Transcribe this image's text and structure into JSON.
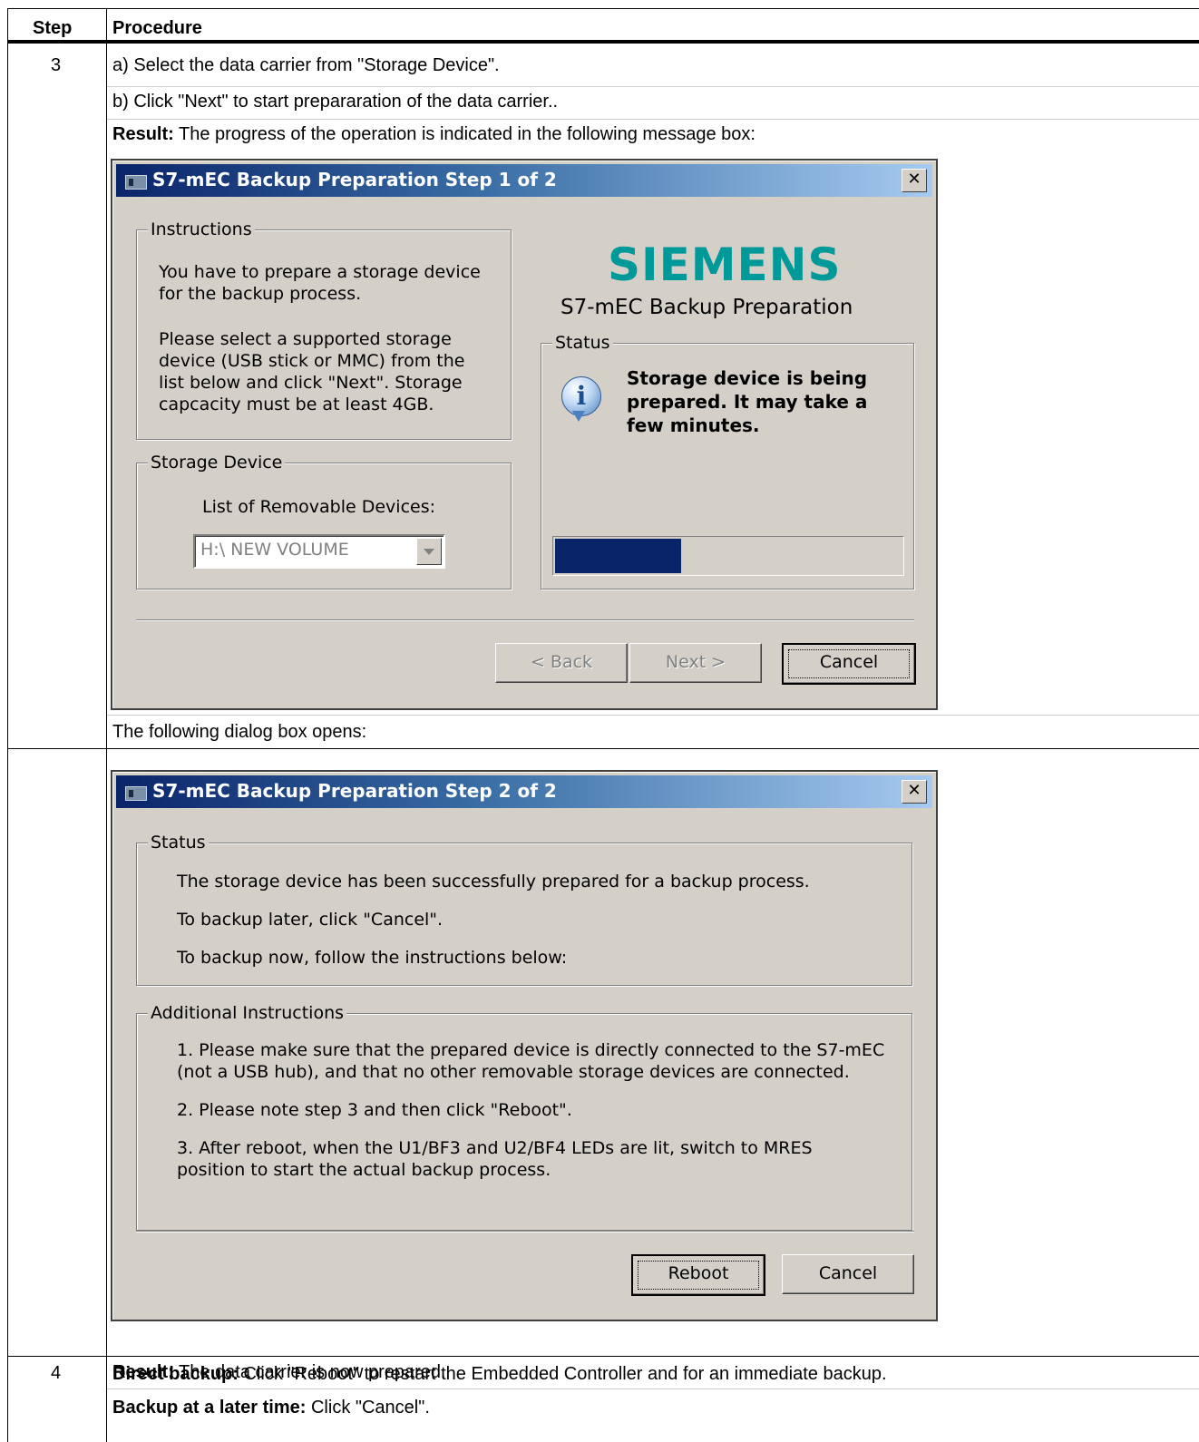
{
  "table": {
    "header": {
      "step": "Step",
      "procedure": "Procedure"
    },
    "rows": [
      {
        "step": "3",
        "line_a": "a) Select the data carrier from \"Storage Device\".",
        "line_b": "b) Click \"Next\" to start prepararation of the data carrier..",
        "result_label": "Result:",
        "result_text": "The progress of the operation is indicated in the following message box:",
        "after_dialog": "The following dialog box opens:"
      },
      {
        "step": "",
        "result_label": "Result:",
        "result_text": "The data carrier is now prepared."
      },
      {
        "step": "4",
        "direct_label": "Direct backup:",
        "direct_text": "Click \"Reboot\" to restart the Embedded Controller and for an immediate backup.",
        "later_label": "Backup at a later time:",
        "later_text": "Click \"Cancel\"."
      }
    ]
  },
  "dialog1": {
    "title": "S7-mEC Backup Preparation Step 1 of 2",
    "close_glyph": "✕",
    "instructions": {
      "legend": "Instructions",
      "p1_line1": "You have to prepare a storage device",
      "p1_line2": "for the backup process.",
      "p2_line1": "Please select a supported storage",
      "p2_line2": "device (USB stick or MMC) from the",
      "p2_line3": "list below and click \"Next\". Storage",
      "p2_line4": "capcacity must be at least 4GB."
    },
    "storage": {
      "legend": "Storage Device",
      "list_label": "List of Removable Devices:",
      "selected": "H:\\ NEW VOLUME"
    },
    "brand": "SIEMENS",
    "product": "S7-mEC Backup Preparation",
    "status": {
      "legend": "Status",
      "line1": "Storage device is being",
      "line2": "prepared. It may take a",
      "line3": "few minutes.",
      "progress_fraction": 0.37
    },
    "buttons": {
      "back": "< Back",
      "next": "Next >",
      "cancel": "Cancel"
    },
    "icon_names": {
      "title": "app-window-icon",
      "status": "info-icon"
    }
  },
  "dialog2": {
    "title": "S7-mEC Backup Preparation Step 2 of 2",
    "close_glyph": "✕",
    "status": {
      "legend": "Status",
      "line1": "The storage device has been successfully prepared for a backup process.",
      "line2": "To backup later, click \"Cancel\".",
      "line3": "To backup now, follow the instructions below:"
    },
    "additional": {
      "legend": "Additional Instructions",
      "i1_line1": "1. Please make sure that the prepared device is directly connected to the S7-mEC",
      "i1_line2": "(not a USB hub), and that no other removable storage devices are connected.",
      "i2": "2. Please note step 3 and then click \"Reboot\".",
      "i3_line1": "3. After reboot, when the U1/BF3 and U2/BF4 LEDs are lit, switch to MRES",
      "i3_line2": "position to start the actual backup process."
    },
    "buttons": {
      "reboot": "Reboot",
      "cancel": "Cancel"
    }
  },
  "colors": {
    "dialog_face": "#d4d0c8",
    "title_gradient_start": "#0a246a",
    "title_gradient_end": "#a6caf0",
    "siemens_brand": "#009999",
    "progress_fill": "#0a246a"
  }
}
